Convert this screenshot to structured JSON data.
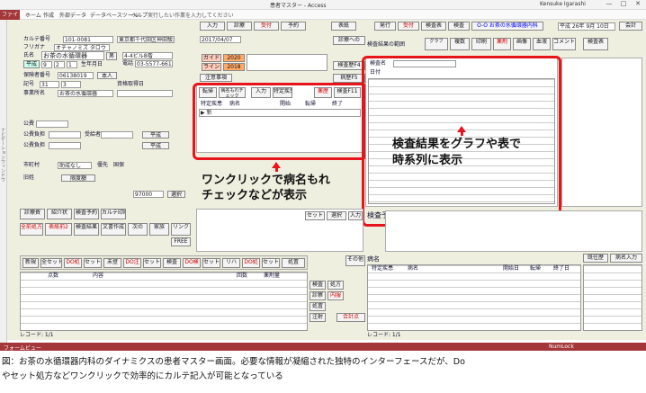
{
  "window": {
    "title": "患者マスター - Access",
    "user": "Kensuke Igarashi",
    "controls": [
      "—",
      "□",
      "✕"
    ]
  },
  "ribbon": {
    "file": "ファイル",
    "tabs": [
      "ホーム",
      "作成",
      "外部データ",
      "データベースツール",
      "ヘルプ"
    ],
    "search": "実行したい作業を入力してください"
  },
  "left_strip": "ナビゲーションウィンドウ",
  "patient": {
    "karte_label": "カルテ番号",
    "karte_value": "101-0081",
    "furigana_label": "フリガナ",
    "furigana_value": "オチャノミズ タロウ",
    "name_label": "氏名",
    "name_value": "お茶の水循環器",
    "sex_label": "男",
    "age": "4-4ビル8階",
    "address_value": "東京都千代田区神田駿河台",
    "phone_label": "電話",
    "phone_value": "03-5577-6613",
    "birth_label": "生年月日",
    "era": "平成",
    "birth_y": "9",
    "birth_m": "2",
    "birth_d": "1",
    "hoken_label": "保険者番号",
    "hoken_value": "06138019",
    "kigo_label": "記号",
    "kigo_value": "31",
    "bango_value": "3",
    "honnin": "本人",
    "jimusho_label": "事業所名",
    "jimusho_value": "お茶の水循環器",
    "shikaku_label": "資格取得日",
    "kouhi_label": "公費",
    "kouhi1": "公費負担",
    "kouhi2": "公費負担",
    "juukyu": "受給者",
    "city_label": "市町村",
    "tokurei": "助成なし",
    "yusen": "優先",
    "kokuseki": "国保",
    "status_note": "旧姓",
    "shiyou": "限度額",
    "kin": "97000",
    "sentaku": "選択"
  },
  "top_buttons": {
    "nyuryoku": "入力",
    "shinryo": "診療",
    "uketsuke": "受付",
    "yoyaku": "予約",
    "hyoshi": "表紙",
    "hakkou": "発行",
    "uketsuke2": "受付",
    "kensa_hyo": "検査表",
    "kensa_mb": "検査",
    "clinic": "O-O お茶の水循環器内科",
    "date": "平成 26年 9月 10日",
    "shinsatsu": "診察",
    "kaikei": "会計"
  },
  "calendar": {
    "date_box": "2017/04/07",
    "year1": "2020",
    "year2": "2018",
    "guide": "ガイド",
    "line": "ライン",
    "days": [
      "1",
      "2",
      "3",
      "4",
      "5",
      "6",
      "7",
      "8",
      "9",
      "10",
      "11",
      "12"
    ],
    "chumon": "注意事項",
    "shinryo_label": "診療への"
  },
  "disease_panel": {
    "tabs": [
      "転帰",
      "病名もれチェック",
      "特定疾患",
      "入力",
      "薬歴",
      "検診"
    ],
    "header_cols": [
      "特定疾患",
      "病名",
      "開始",
      "転帰",
      "終了"
    ],
    "row1": "▶ 新",
    "kensa_f11": "検査F11",
    "shinryo_f5": "病歴F5",
    "kensa_f4": "検査歴F4",
    "callout": [
      "ワンクリックで病名もれ",
      "チェックなどが表示"
    ]
  },
  "results_panel": {
    "title": "検査結果の範囲",
    "graph": "グラフ",
    "fukusu": "複数",
    "insatsu": "印刷",
    "yakuzai": "薬剤",
    "gazou": "画像",
    "ketsueki": "血液",
    "comment": "コメント",
    "kensa_hyou": "検査表",
    "kensa_mei": "検査名",
    "hyouji": "表示",
    "graph2": "グラフ",
    "shikkan": "疾患",
    "date_col": "日付",
    "callout": [
      "検査結果をグラフや表で",
      "時系列に表示"
    ]
  },
  "middle": {
    "shinryou": "診療費",
    "shoukai": "紹介状",
    "karte_in": "カルテ印刷",
    "kensa_y": "検査予約",
    "kensa_kekka": "検査結果",
    "bunsho": "文書作成",
    "zenki": "全前処方",
    "hyoukyaku": "表紙前2",
    "kazoku": "家族",
    "link": "リンク",
    "next": "次の",
    "free": "FREE",
    "set_btn": "セット",
    "sentaku": "選択",
    "nyuuryoku": "入力",
    "kensa_vert": "検査予",
    "shiji": "指示",
    "koumoku": "処置",
    "yakuzai": "薬剤料"
  },
  "bottom_toolbar": {
    "items": [
      "新規",
      "全セット",
      "DO処",
      "セット",
      "未登",
      "DO注",
      "セット",
      "検査",
      "DO検",
      "セット",
      "リハ",
      "DO処",
      "セット",
      "処置"
    ],
    "col_headers": [
      "点数",
      "内容",
      "回数",
      "薬剤量"
    ],
    "kensa": "検査",
    "shoho": "処方",
    "sono": "その他",
    "shinsatsu": "診察",
    "shochi": "処置",
    "chusha": "注射",
    "goukei": "合計点",
    "record": "レコード: 1/1",
    "naifuku": "内服"
  },
  "byomei_panel": {
    "title": "病名",
    "tokutei": "特定疾患",
    "mei": "病名",
    "kaishi": "開始日",
    "tenki": "転帰",
    "shuryo": "終了日",
    "kiou": "既往歴",
    "byomei_nyu": "病名入力",
    "side": "仕付",
    "kako": "その他",
    "record": "レコード: 1/1"
  },
  "statusbar": {
    "left": "フォームビュー",
    "right": "NumLock"
  },
  "caption": {
    "line1": "図：お茶の水循環器内科のダイナミクスの患者マスター画面。必要な情報が凝縮された独特のインターフェースだが、Do",
    "line2": "やセット処方などワンクリックで効率的にカルテ記入が可能となっている"
  },
  "colors": {
    "accent": "#a4373a",
    "highlight": "#e8141c",
    "form_bg": "#efefe0"
  }
}
